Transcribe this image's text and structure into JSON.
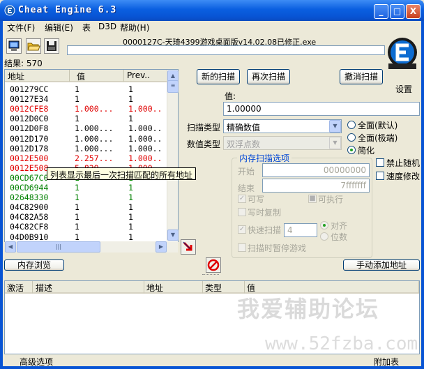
{
  "window": {
    "title": "Cheat Engine 6.3",
    "controls": [
      "_",
      "□",
      "X"
    ]
  },
  "menu": [
    "文件(F)",
    "编辑(E)",
    "表",
    "D3D",
    "帮助(H)"
  ],
  "process_title": "0000127C-天琦4399游戏桌面版v14.02.08已修正.exe",
  "results_label": "结果: 570",
  "logo_caption": "设置",
  "address_list": {
    "headers": [
      "地址",
      "值",
      "Prev.."
    ],
    "rows": [
      {
        "address": "001279CC",
        "value": "1",
        "prev": "1",
        "color": "#000000"
      },
      {
        "address": "00127E34",
        "value": "1",
        "prev": "1",
        "color": "#000000"
      },
      {
        "address": "0012CFE8",
        "value": "1.000...",
        "prev": "1.000..",
        "color": "#e00000"
      },
      {
        "address": "0012D0C0",
        "value": "1",
        "prev": "1",
        "color": "#000000"
      },
      {
        "address": "0012D0F8",
        "value": "1.000...",
        "prev": "1.000..",
        "color": "#000000"
      },
      {
        "address": "0012D170",
        "value": "1.000...",
        "prev": "1.000..",
        "color": "#000000"
      },
      {
        "address": "0012D178",
        "value": "1.000...",
        "prev": "1.000..",
        "color": "#000000"
      },
      {
        "address": "0012E500",
        "value": "2.257...",
        "prev": "1.000..",
        "color": "#e00000"
      },
      {
        "address": "0012E508",
        "value": "5.839...",
        "prev": "1.000..",
        "color": "#e00000"
      },
      {
        "address": "00CD67C0",
        "value": "1",
        "prev": "1",
        "color": "#008000"
      },
      {
        "address": "00CD6944",
        "value": "1",
        "prev": "1",
        "color": "#008000"
      },
      {
        "address": "02648330",
        "value": "1",
        "prev": "1",
        "color": "#008000"
      },
      {
        "address": "04C82900",
        "value": "1",
        "prev": "1",
        "color": "#000000"
      },
      {
        "address": "04C82A58",
        "value": "1",
        "prev": "1",
        "color": "#000000"
      },
      {
        "address": "04C82CF8",
        "value": "1",
        "prev": "1",
        "color": "#000000"
      },
      {
        "address": "04D0B910",
        "value": "1",
        "prev": "1",
        "color": "#000000"
      }
    ]
  },
  "tooltip": "列表显示最后一次扫描匹配的所有地址",
  "scan": {
    "new_scan": "新的扫描",
    "next_scan": "再次扫描",
    "undo_scan": "撤消扫描",
    "value_label": "值:",
    "value": "1.00000",
    "scan_type_label": "扫描类型",
    "scan_type": "精确数值",
    "value_type_label": "数值类型",
    "value_type": "双浮点数"
  },
  "radios": {
    "all_default": "全面(默认)",
    "all_extreme": "全面(极端)",
    "simple": "简化"
  },
  "checks": {
    "no_random": "禁止随机",
    "speed_hack": "速度修改"
  },
  "memory_options": {
    "title": "内存扫描选项",
    "start_label": "开始",
    "start_value": "00000000",
    "end_label": "结束",
    "end_value": "7fffffff",
    "writable": "可写",
    "executable": "可执行",
    "copy_on_write": "写时复制",
    "fast_scan": "快速扫描",
    "fast_scan_value": "4",
    "align": "对齐",
    "last_digits": "位数",
    "pause_game": "扫描时暂停游戏"
  },
  "memory_view": "内存浏览",
  "add_manual": "手动添加地址",
  "cheat_table": {
    "headers": [
      "激活",
      "描述",
      "地址",
      "类型",
      "值"
    ]
  },
  "watermark": "我爱辅助论坛",
  "watermark_url": "www.52fzba.com",
  "status": {
    "advanced": "高级选项",
    "table_extras": "附加表"
  }
}
